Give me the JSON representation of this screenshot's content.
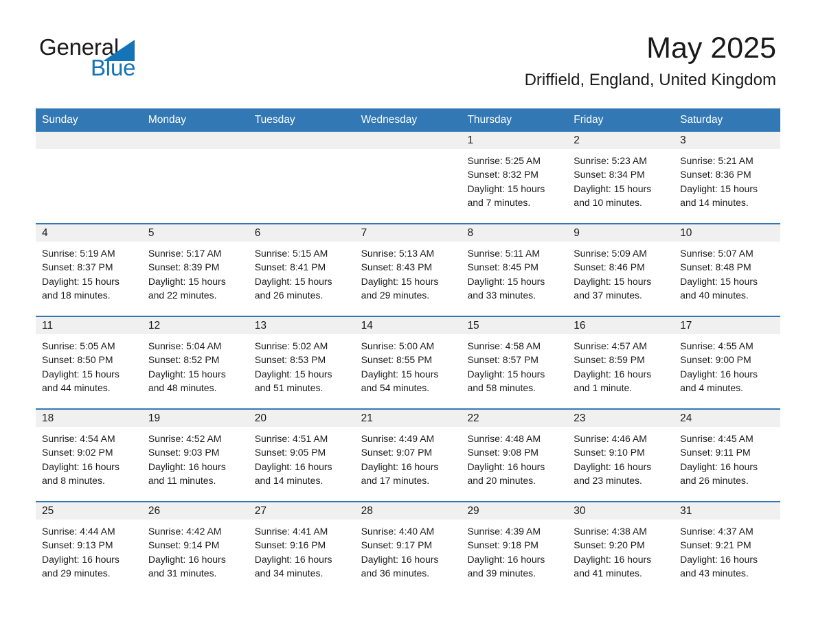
{
  "brand": {
    "name_part1": "General",
    "name_part2": "Blue",
    "logo_color": "#1573b8"
  },
  "header": {
    "month_title": "May 2025",
    "location": "Driffield, England, United Kingdom"
  },
  "theme": {
    "header_blue": "#3178b5",
    "date_band_gray": "#f0f0f0",
    "text_color": "#1a1a1a"
  },
  "calendar": {
    "weekday_headers": [
      "Sunday",
      "Monday",
      "Tuesday",
      "Wednesday",
      "Thursday",
      "Friday",
      "Saturday"
    ],
    "weeks": [
      [
        {
          "day": "",
          "empty": true
        },
        {
          "day": "",
          "empty": true
        },
        {
          "day": "",
          "empty": true
        },
        {
          "day": "",
          "empty": true
        },
        {
          "day": "1",
          "sunrise": "Sunrise: 5:25 AM",
          "sunset": "Sunset: 8:32 PM",
          "daylight": "Daylight: 15 hours and 7 minutes."
        },
        {
          "day": "2",
          "sunrise": "Sunrise: 5:23 AM",
          "sunset": "Sunset: 8:34 PM",
          "daylight": "Daylight: 15 hours and 10 minutes."
        },
        {
          "day": "3",
          "sunrise": "Sunrise: 5:21 AM",
          "sunset": "Sunset: 8:36 PM",
          "daylight": "Daylight: 15 hours and 14 minutes."
        }
      ],
      [
        {
          "day": "4",
          "sunrise": "Sunrise: 5:19 AM",
          "sunset": "Sunset: 8:37 PM",
          "daylight": "Daylight: 15 hours and 18 minutes."
        },
        {
          "day": "5",
          "sunrise": "Sunrise: 5:17 AM",
          "sunset": "Sunset: 8:39 PM",
          "daylight": "Daylight: 15 hours and 22 minutes."
        },
        {
          "day": "6",
          "sunrise": "Sunrise: 5:15 AM",
          "sunset": "Sunset: 8:41 PM",
          "daylight": "Daylight: 15 hours and 26 minutes."
        },
        {
          "day": "7",
          "sunrise": "Sunrise: 5:13 AM",
          "sunset": "Sunset: 8:43 PM",
          "daylight": "Daylight: 15 hours and 29 minutes."
        },
        {
          "day": "8",
          "sunrise": "Sunrise: 5:11 AM",
          "sunset": "Sunset: 8:45 PM",
          "daylight": "Daylight: 15 hours and 33 minutes."
        },
        {
          "day": "9",
          "sunrise": "Sunrise: 5:09 AM",
          "sunset": "Sunset: 8:46 PM",
          "daylight": "Daylight: 15 hours and 37 minutes."
        },
        {
          "day": "10",
          "sunrise": "Sunrise: 5:07 AM",
          "sunset": "Sunset: 8:48 PM",
          "daylight": "Daylight: 15 hours and 40 minutes."
        }
      ],
      [
        {
          "day": "11",
          "sunrise": "Sunrise: 5:05 AM",
          "sunset": "Sunset: 8:50 PM",
          "daylight": "Daylight: 15 hours and 44 minutes."
        },
        {
          "day": "12",
          "sunrise": "Sunrise: 5:04 AM",
          "sunset": "Sunset: 8:52 PM",
          "daylight": "Daylight: 15 hours and 48 minutes."
        },
        {
          "day": "13",
          "sunrise": "Sunrise: 5:02 AM",
          "sunset": "Sunset: 8:53 PM",
          "daylight": "Daylight: 15 hours and 51 minutes."
        },
        {
          "day": "14",
          "sunrise": "Sunrise: 5:00 AM",
          "sunset": "Sunset: 8:55 PM",
          "daylight": "Daylight: 15 hours and 54 minutes."
        },
        {
          "day": "15",
          "sunrise": "Sunrise: 4:58 AM",
          "sunset": "Sunset: 8:57 PM",
          "daylight": "Daylight: 15 hours and 58 minutes."
        },
        {
          "day": "16",
          "sunrise": "Sunrise: 4:57 AM",
          "sunset": "Sunset: 8:59 PM",
          "daylight": "Daylight: 16 hours and 1 minute."
        },
        {
          "day": "17",
          "sunrise": "Sunrise: 4:55 AM",
          "sunset": "Sunset: 9:00 PM",
          "daylight": "Daylight: 16 hours and 4 minutes."
        }
      ],
      [
        {
          "day": "18",
          "sunrise": "Sunrise: 4:54 AM",
          "sunset": "Sunset: 9:02 PM",
          "daylight": "Daylight: 16 hours and 8 minutes."
        },
        {
          "day": "19",
          "sunrise": "Sunrise: 4:52 AM",
          "sunset": "Sunset: 9:03 PM",
          "daylight": "Daylight: 16 hours and 11 minutes."
        },
        {
          "day": "20",
          "sunrise": "Sunrise: 4:51 AM",
          "sunset": "Sunset: 9:05 PM",
          "daylight": "Daylight: 16 hours and 14 minutes."
        },
        {
          "day": "21",
          "sunrise": "Sunrise: 4:49 AM",
          "sunset": "Sunset: 9:07 PM",
          "daylight": "Daylight: 16 hours and 17 minutes."
        },
        {
          "day": "22",
          "sunrise": "Sunrise: 4:48 AM",
          "sunset": "Sunset: 9:08 PM",
          "daylight": "Daylight: 16 hours and 20 minutes."
        },
        {
          "day": "23",
          "sunrise": "Sunrise: 4:46 AM",
          "sunset": "Sunset: 9:10 PM",
          "daylight": "Daylight: 16 hours and 23 minutes."
        },
        {
          "day": "24",
          "sunrise": "Sunrise: 4:45 AM",
          "sunset": "Sunset: 9:11 PM",
          "daylight": "Daylight: 16 hours and 26 minutes."
        }
      ],
      [
        {
          "day": "25",
          "sunrise": "Sunrise: 4:44 AM",
          "sunset": "Sunset: 9:13 PM",
          "daylight": "Daylight: 16 hours and 29 minutes."
        },
        {
          "day": "26",
          "sunrise": "Sunrise: 4:42 AM",
          "sunset": "Sunset: 9:14 PM",
          "daylight": "Daylight: 16 hours and 31 minutes."
        },
        {
          "day": "27",
          "sunrise": "Sunrise: 4:41 AM",
          "sunset": "Sunset: 9:16 PM",
          "daylight": "Daylight: 16 hours and 34 minutes."
        },
        {
          "day": "28",
          "sunrise": "Sunrise: 4:40 AM",
          "sunset": "Sunset: 9:17 PM",
          "daylight": "Daylight: 16 hours and 36 minutes."
        },
        {
          "day": "29",
          "sunrise": "Sunrise: 4:39 AM",
          "sunset": "Sunset: 9:18 PM",
          "daylight": "Daylight: 16 hours and 39 minutes."
        },
        {
          "day": "30",
          "sunrise": "Sunrise: 4:38 AM",
          "sunset": "Sunset: 9:20 PM",
          "daylight": "Daylight: 16 hours and 41 minutes."
        },
        {
          "day": "31",
          "sunrise": "Sunrise: 4:37 AM",
          "sunset": "Sunset: 9:21 PM",
          "daylight": "Daylight: 16 hours and 43 minutes."
        }
      ]
    ]
  }
}
